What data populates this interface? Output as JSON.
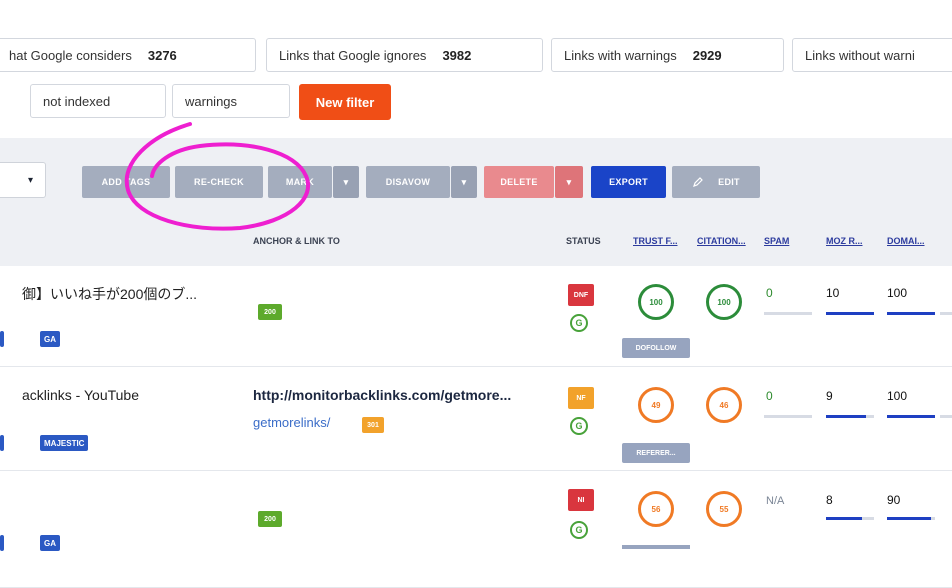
{
  "filters": {
    "chips": [
      {
        "label": "hat Google considers",
        "count": "3276"
      },
      {
        "label": "Links that Google ignores",
        "count": "3982"
      },
      {
        "label": "Links with warnings",
        "count": "2929"
      },
      {
        "label": "Links without warni",
        "count": ""
      }
    ],
    "row2": [
      "not indexed",
      "warnings"
    ],
    "new_filter": "New filter"
  },
  "toolbar": {
    "select_value": "",
    "add_tags": "ADD TAGS",
    "recheck": "RE-CHECK",
    "mark": "MARK",
    "disavow": "DISAVOW",
    "delete": "DELETE",
    "export": "EXPORT",
    "edit": "EDIT",
    "caret": "▾"
  },
  "columns": {
    "anchor": "ANCHOR & LINK TO",
    "status": "STATUS",
    "trust": "TRUST F...",
    "citation": "CITATION...",
    "spam": "SPAM",
    "moz": "MOZ R...",
    "domain": "DOMAI..."
  },
  "rows": [
    {
      "title": "】いいね手が200個のブ...",
      "title_prefix": "御",
      "tags": [
        "GA"
      ],
      "anchor_badge": "200",
      "link_main": "",
      "link_sub": "",
      "status_code": "DNF",
      "status_color": "#d9363e",
      "trust": "100",
      "trust_color": "green",
      "citation": "100",
      "citation_color": "green",
      "spam": "0",
      "moz": "10",
      "domain": "100",
      "button": "DOFOLLOW"
    },
    {
      "title": "acklinks - YouTube",
      "tags": [
        "MAJESTIC"
      ],
      "anchor_badge": "",
      "link_main": "http://monitorbacklinks.com/getmore...",
      "link_sub": "getmorelinks/",
      "link_sub_badge": "301",
      "status_code": "NF",
      "status_color": "#f2a22b",
      "trust": "49",
      "trust_color": "orange",
      "citation": "46",
      "citation_color": "orange",
      "spam": "0",
      "moz": "9",
      "domain": "100",
      "button": "REFERER..."
    },
    {
      "title": "",
      "tags": [
        "GA"
      ],
      "anchor_badge": "200",
      "link_main": "",
      "link_sub": "",
      "status_code": "NI",
      "status_color": "#d9363e",
      "trust": "56",
      "trust_color": "orange",
      "citation": "55",
      "citation_color": "orange",
      "spam": "N/A",
      "moz": "8",
      "domain": "90",
      "button": ""
    }
  ],
  "g_icon_letter": "G"
}
